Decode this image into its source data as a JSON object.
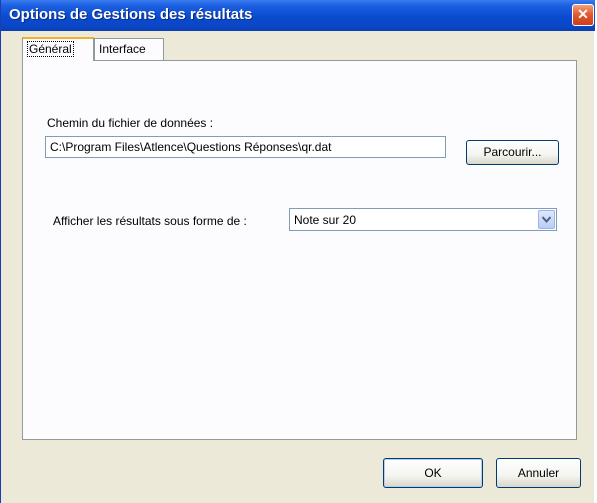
{
  "window": {
    "title": "Options de Gestions des résultats",
    "close_glyph": "✕"
  },
  "tabs": [
    {
      "label": "Général",
      "active": true
    },
    {
      "label": "Interface",
      "active": false
    }
  ],
  "general": {
    "data_path_label": "Chemin du fichier de données :",
    "data_path_value": "C:\\Program Files\\Atlence\\Questions Réponses\\qr.dat",
    "browse_button": "Parcourir...",
    "display_label": "Afficher les résultats sous forme de :",
    "display_selected": "Note sur 20"
  },
  "footer": {
    "ok_button": "OK",
    "cancel_button": "Annuler"
  },
  "icons": {
    "close": "close-icon",
    "dropdown": "chevron-down-icon"
  },
  "colors": {
    "titlebar": "#0a4ad0",
    "dialog_bg": "#ece9d8",
    "panel_bg": "#fcfcfe",
    "close_button": "#e2552c",
    "active_tab_accent": "#f0b030"
  }
}
